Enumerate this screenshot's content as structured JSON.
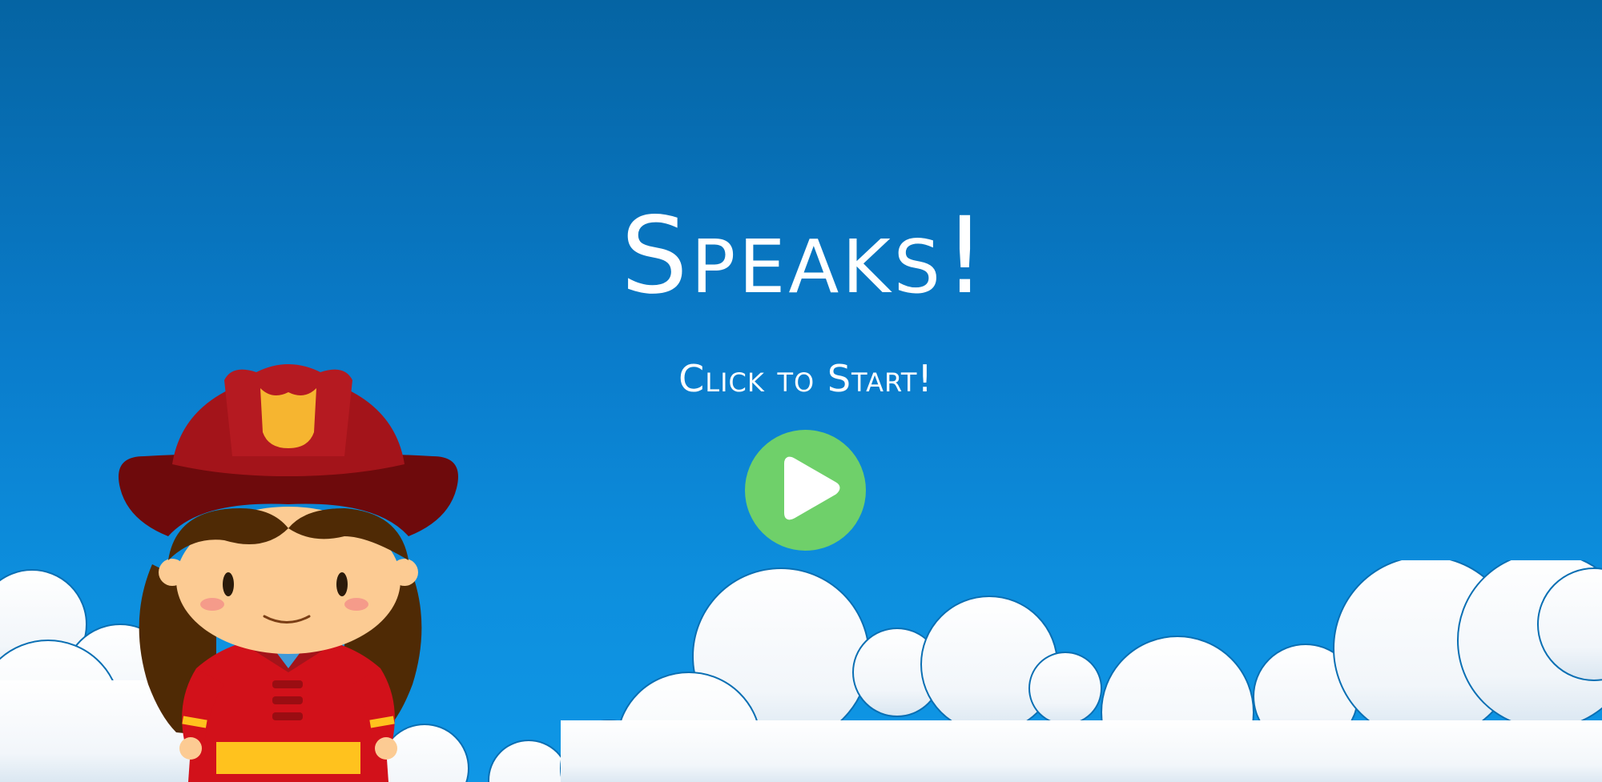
{
  "game": {
    "title": "Speaks!",
    "start_prompt": "Click to Start!"
  },
  "colors": {
    "sky_top": "#0564a3",
    "sky_bottom": "#0f97e6",
    "play_button": "#6fd06a",
    "text": "#ffffff",
    "hat_dark": "#6e0a0c",
    "hat_red": "#a3141a",
    "badge": "#f6b530",
    "coat": "#d2111a",
    "stripe": "#ffc21e",
    "hair": "#4f2a05",
    "skin": "#fccb93"
  },
  "icons": {
    "play": "play-triangle-icon",
    "character": "firefighter-girl",
    "background": "clouds"
  }
}
